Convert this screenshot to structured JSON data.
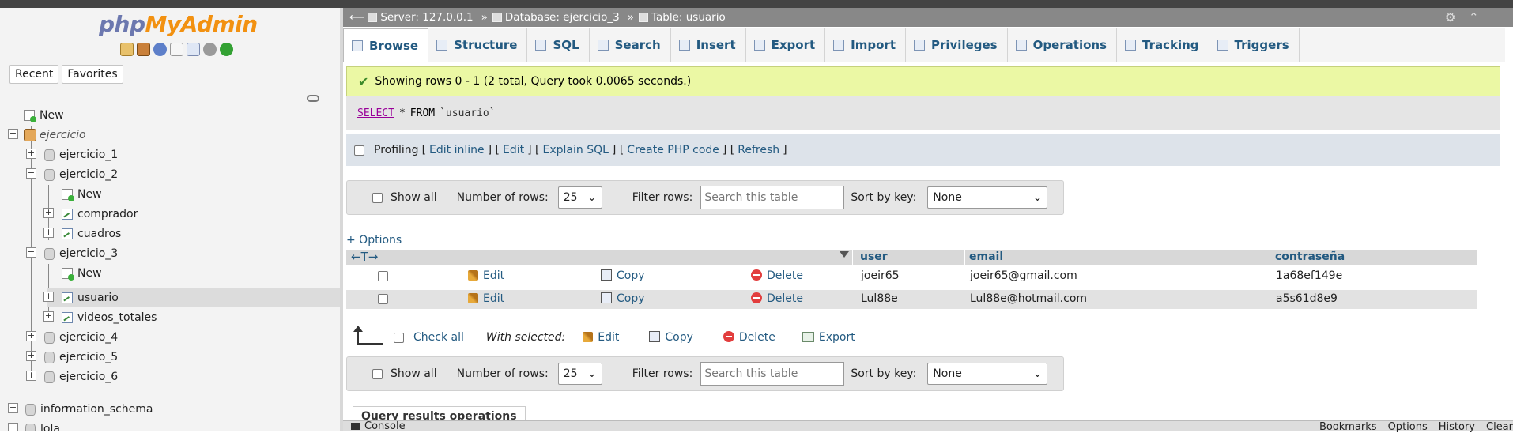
{
  "app": {
    "logo_php": "php",
    "logo_myadmin": "MyAdmin"
  },
  "nav": {
    "tabs": [
      "Recent",
      "Favorites"
    ],
    "tree": {
      "new": "New",
      "ejercicio": "ejercicio",
      "ejercicio_1": "ejercicio_1",
      "ejercicio_2": "ejercicio_2",
      "e2_new": "New",
      "e2_comprador": "comprador",
      "e2_cuadros": "cuadros",
      "ejercicio_3": "ejercicio_3",
      "e3_new": "New",
      "e3_usuario": "usuario",
      "e3_videos": "videos_totales",
      "ejercicio_4": "ejercicio_4",
      "ejercicio_5": "ejercicio_5",
      "ejercicio_6": "ejercicio_6",
      "information_schema": "information_schema",
      "lola": "lola"
    }
  },
  "breadcrumb": {
    "server": "Server: 127.0.0.1",
    "database": "Database: ejercicio_3",
    "table": "Table: usuario",
    "sep": "»"
  },
  "tabs": [
    "Browse",
    "Structure",
    "SQL",
    "Search",
    "Insert",
    "Export",
    "Import",
    "Privileges",
    "Operations",
    "Tracking",
    "Triggers"
  ],
  "result": {
    "message": "Showing rows 0 - 1 (2 total, Query took 0.0065 seconds.)",
    "sql_kw": "SELECT",
    "sql_star": "*",
    "sql_from": "FROM",
    "sql_table": "`usuario`"
  },
  "profiling": {
    "label": "Profiling",
    "links": [
      "Edit inline",
      "Edit",
      "Explain SQL",
      "Create PHP code",
      "Refresh"
    ]
  },
  "navbar": {
    "show_all": "Show all",
    "num_rows_label": "Number of rows:",
    "num_rows_value": "25",
    "filter_label": "Filter rows:",
    "filter_placeholder": "Search this table",
    "sort_label": "Sort by key:",
    "sort_value": "None"
  },
  "options_link": "+ Options",
  "table": {
    "columns": [
      "user",
      "email",
      "contraseña"
    ],
    "arrows": "←T→",
    "actions": [
      "Edit",
      "Copy",
      "Delete"
    ],
    "rows": [
      [
        "joeir65",
        "joeir65@gmail.com",
        "1a68ef149e"
      ],
      [
        "Lul88e",
        "Lul88e@hotmail.com",
        "a5s61d8e9"
      ]
    ]
  },
  "with_selected": {
    "check_all": "Check all",
    "label": "With selected:",
    "actions": [
      "Edit",
      "Copy",
      "Delete",
      "Export"
    ]
  },
  "query_results_ops": "Query results operations",
  "console": {
    "label": "Console",
    "right": [
      "Bookmarks",
      "Options",
      "History",
      "Clear"
    ]
  }
}
